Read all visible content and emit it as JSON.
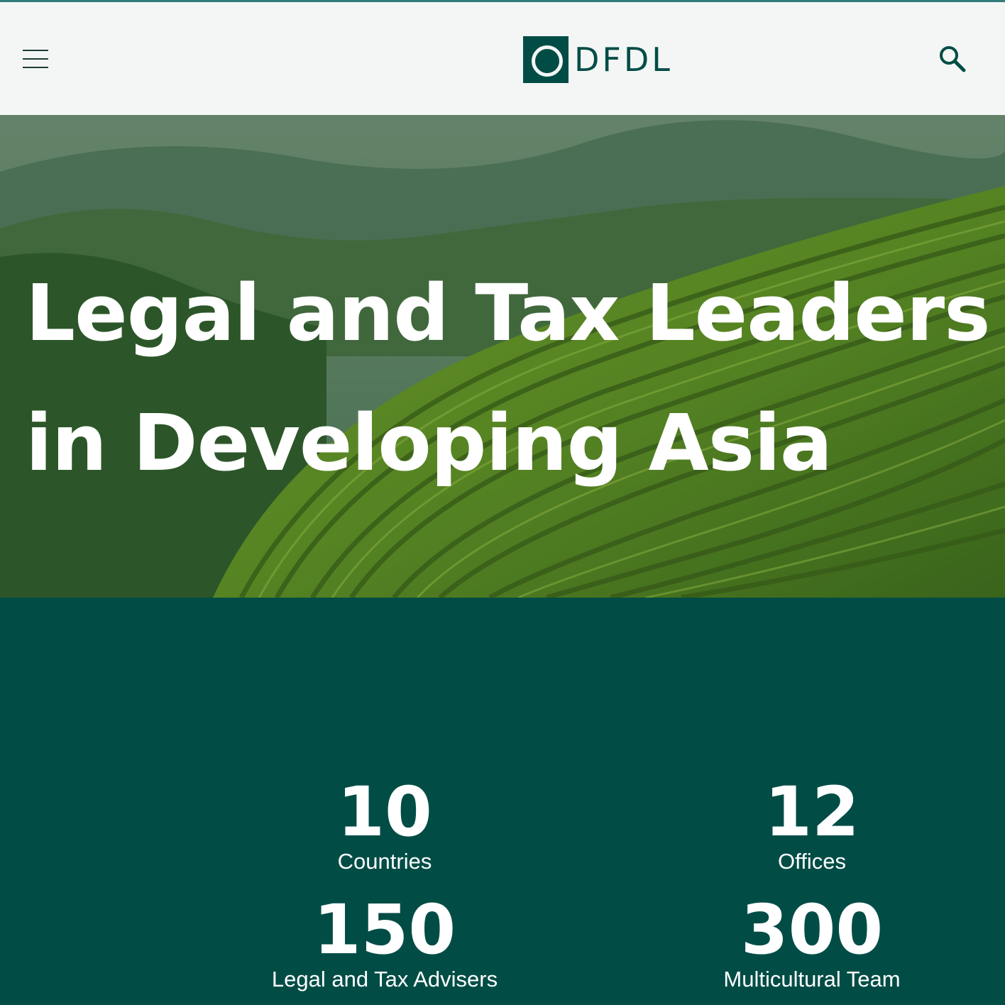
{
  "header": {
    "menu_icon": "hamburger-menu-icon",
    "logo_text": "DFDL",
    "search_icon": "search-icon"
  },
  "hero": {
    "title_line1": "Legal and Tax Leaders",
    "title_line2": "in Developing Asia"
  },
  "stats": [
    {
      "value": "10",
      "label": "Countries"
    },
    {
      "value": "12",
      "label": "Offices"
    },
    {
      "value": "150",
      "label": "Legal and Tax Advisers"
    },
    {
      "value": "300",
      "label": "Multicultural Team"
    }
  ],
  "colors": {
    "brand_green": "#014d46",
    "header_bg": "#f4f6f5",
    "text_white": "#ffffff"
  }
}
